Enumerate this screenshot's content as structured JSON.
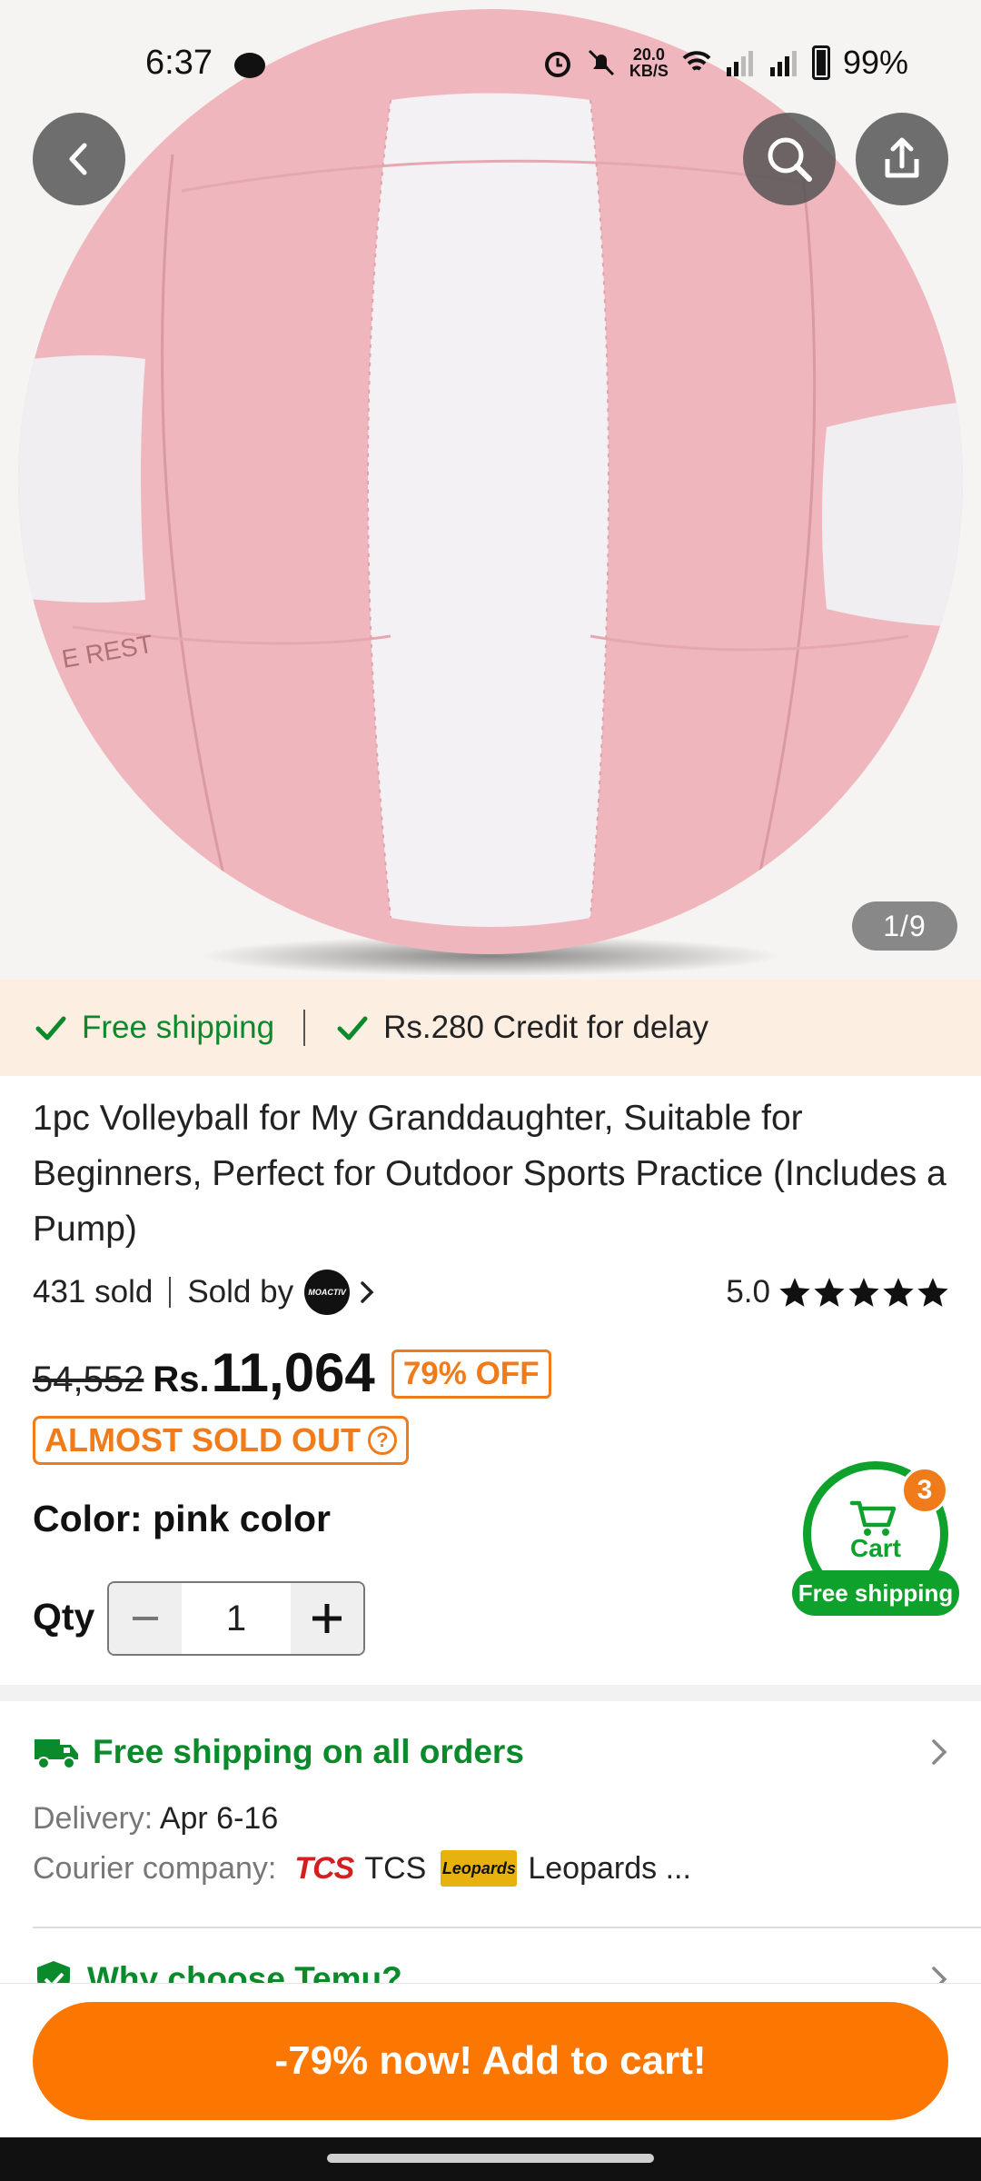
{
  "status_bar": {
    "time": "6:37",
    "net_speed_value": "20.0",
    "net_speed_unit": "KB/S",
    "battery": "99%"
  },
  "gallery": {
    "counter": "1/9",
    "ball_colors": {
      "pink": "#f0b6bd",
      "white": "#f4f1f4"
    }
  },
  "shipping_banner": {
    "free_shipping": "Free shipping",
    "credit": "Rs.280 Credit for delay"
  },
  "product": {
    "title": "1pc Volleyball for My Granddaughter, Suitable for Beginners, Perfect for Outdoor Sports Practice (Includes a Pump)",
    "sold_count": "431 sold",
    "sold_by_label": "Sold by",
    "seller_logo_text": "MOACTIV",
    "rating": "5.0",
    "stars": 5,
    "old_price": "54,552",
    "currency": "Rs.",
    "price": "11,064",
    "discount": "79% OFF",
    "stock_badge": "ALMOST SOLD OUT",
    "color_label": "Color: pink color",
    "qty_label": "Qty",
    "qty_value": "1"
  },
  "floating_cart": {
    "label": "Cart",
    "count": "3",
    "shipping": "Free shipping"
  },
  "shipping_info": {
    "title": "Free shipping on all orders",
    "delivery_label": "Delivery:",
    "delivery_value": "Apr 6-16",
    "courier_label": "Courier company:",
    "courier_1_logo": "TCS",
    "courier_1": "TCS",
    "courier_2_logo": "Leopards",
    "courier_2": "Leopards ..."
  },
  "why_section": {
    "title": "Why choose Temu?"
  },
  "cta": {
    "label": "-79% now! Add to cart!"
  },
  "colors": {
    "accent_orange": "#fb7701",
    "green": "#0a8a2a",
    "banner_bg": "#fdeee2"
  }
}
